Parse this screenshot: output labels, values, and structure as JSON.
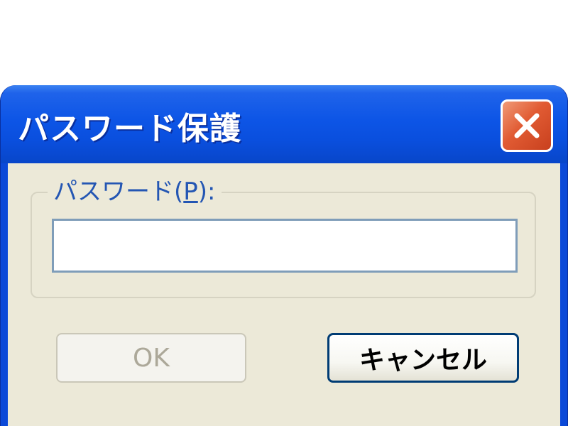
{
  "window": {
    "title": "パスワード保護",
    "close_icon": "close-icon"
  },
  "password_group": {
    "label_prefix": "パスワード(",
    "label_accelerator": "P",
    "label_suffix": "):",
    "input_value": "",
    "input_placeholder": ""
  },
  "buttons": {
    "ok_label": "OK",
    "ok_enabled": false,
    "cancel_label": "キャンセル"
  },
  "colors": {
    "titlebar_blue": "#0d55e6",
    "close_red": "#e15b33",
    "dialog_face": "#ece9d8",
    "group_label_blue": "#2456b3",
    "input_border": "#7f9db9",
    "default_button_border": "#003c74"
  }
}
